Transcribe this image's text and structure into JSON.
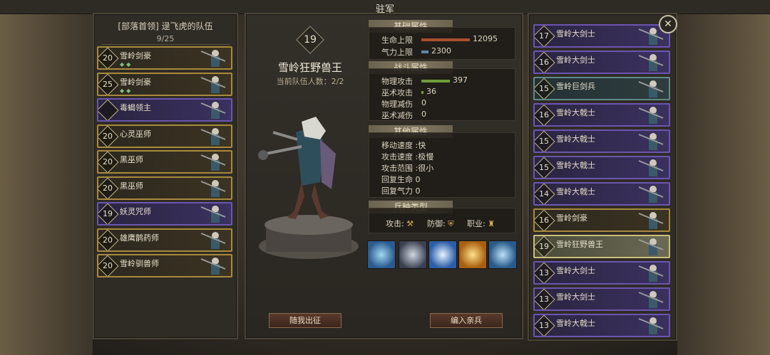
{
  "title": "驻军",
  "left_panel": {
    "header": "[部落首领] 逯飞虎的队伍",
    "count": "9/25",
    "units": [
      {
        "level": "20",
        "name": "雪岭剑豪",
        "style": "gold",
        "gems": true
      },
      {
        "level": "25",
        "name": "雪岭剑豪",
        "style": "gold",
        "gems": true
      },
      {
        "level": "",
        "name": "毒蝎领主",
        "style": "purple",
        "gems": false
      },
      {
        "level": "20",
        "name": "心灵巫师",
        "style": "gold",
        "gems": false
      },
      {
        "level": "20",
        "name": "黑巫师",
        "style": "gold",
        "gems": false
      },
      {
        "level": "20",
        "name": "黑巫师",
        "style": "gold",
        "gems": false
      },
      {
        "level": "19",
        "name": "妖灵咒师",
        "style": "purple",
        "gems": false
      },
      {
        "level": "20",
        "name": "雄鹰鹊药师",
        "style": "gold",
        "gems": false
      },
      {
        "level": "20",
        "name": "雪岭驯兽师",
        "style": "gold",
        "gems": false
      }
    ]
  },
  "hero": {
    "level": "19",
    "name": "雪岭狂野兽王",
    "count_label": "当前队伍人数：2/2"
  },
  "sections": {
    "basic": "基础属性",
    "combat": "战斗属性",
    "other": "其他属性",
    "type": "兵种类型"
  },
  "basic_stats": [
    {
      "label": "生命上限",
      "value": "12095",
      "bar_fraction": 0.85,
      "color": "#a8502c"
    },
    {
      "label": "气力上限",
      "value": "2300",
      "bar_fraction": 0.12,
      "color": "#5c86a8"
    }
  ],
  "combat_stats": [
    {
      "label": "物理攻击",
      "value": "397",
      "bar_fraction": 0.5,
      "color": "#6e9c3a"
    },
    {
      "label": "巫术攻击",
      "value": "36",
      "bar_fraction": 0.02,
      "color": "#6e9c3a"
    },
    {
      "label": "物理减伤",
      "value": "0"
    },
    {
      "label": "巫术减伤",
      "value": "0"
    }
  ],
  "other_stats": [
    {
      "text": "移动速度 :快"
    },
    {
      "text": "攻击速度 :极慢"
    },
    {
      "text": "攻击范围 :很小"
    },
    {
      "text": "回复生命  0"
    },
    {
      "text": "回复气力  0"
    }
  ],
  "type_row": {
    "attack": "攻击:",
    "defense": "防御:",
    "job": "职业:"
  },
  "skills": [
    "ice-burst-icon",
    "iron-boots-icon",
    "wolf-claw-icon",
    "golden-aura-icon",
    "wolf-howl-icon"
  ],
  "buttons": {
    "follow": "随我出征",
    "recruit": "编入亲兵"
  },
  "right_panel": {
    "units": [
      {
        "level": "17",
        "name": "雪岭大剑士",
        "style": "purple"
      },
      {
        "level": "16",
        "name": "雪岭大剑士",
        "style": "purple"
      },
      {
        "level": "15",
        "name": "雪岭巨剑兵",
        "style": "teal"
      },
      {
        "level": "16",
        "name": "雪岭大戟士",
        "style": "purple"
      },
      {
        "level": "15",
        "name": "雪岭大戟士",
        "style": "purple"
      },
      {
        "level": "15",
        "name": "雪岭大戟士",
        "style": "purple"
      },
      {
        "level": "14",
        "name": "雪岭大戟士",
        "style": "purple"
      },
      {
        "level": "16",
        "name": "雪岭剑豪",
        "style": "gold"
      },
      {
        "level": "19",
        "name": "雪岭狂野兽王",
        "style": "gold selected"
      },
      {
        "level": "13",
        "name": "雪岭大剑士",
        "style": "purple"
      },
      {
        "level": "13",
        "name": "雪岭大剑士",
        "style": "purple"
      },
      {
        "level": "13",
        "name": "雪岭大戟士",
        "style": "purple"
      }
    ]
  }
}
